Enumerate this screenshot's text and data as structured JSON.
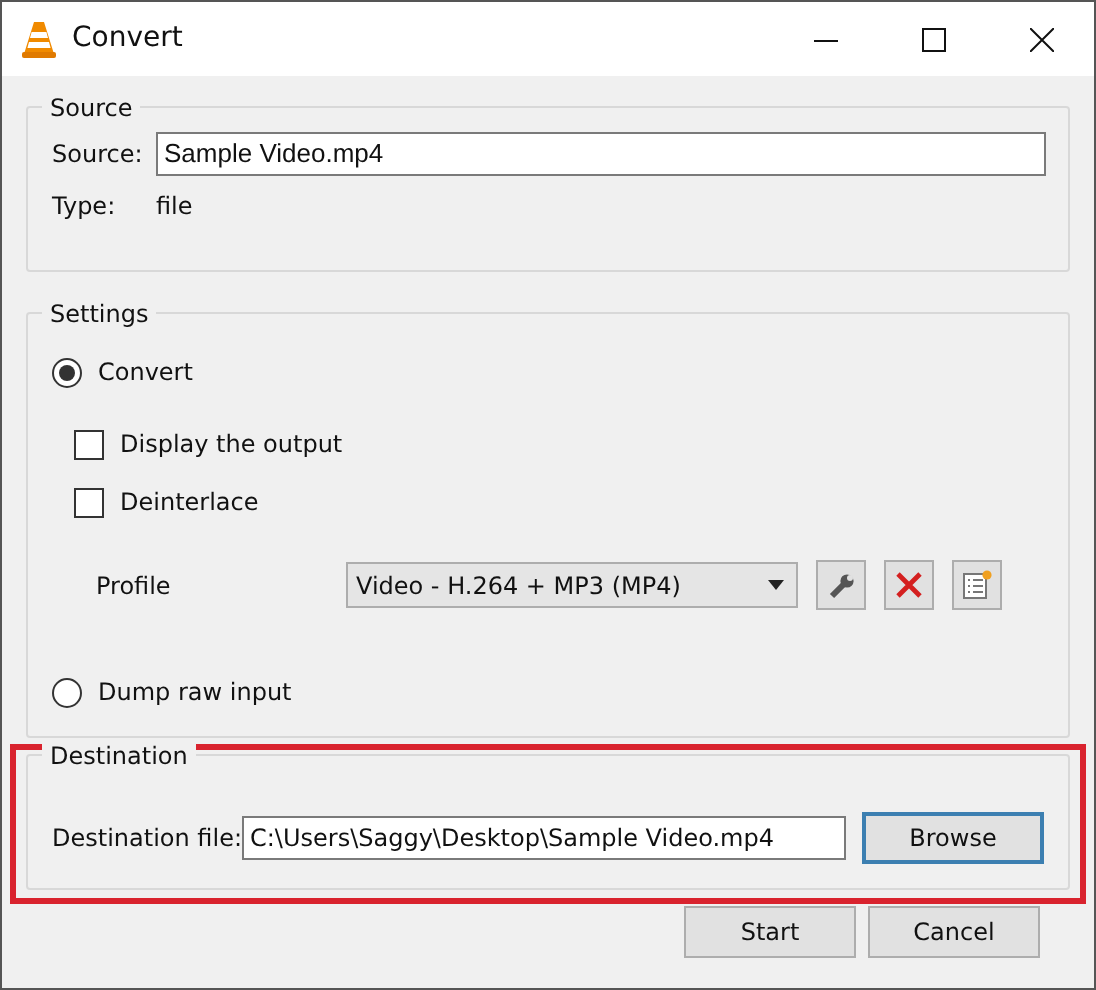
{
  "window": {
    "title": "Convert"
  },
  "source": {
    "legend": "Source",
    "source_label": "Source:",
    "source_value": "Sample Video.mp4",
    "type_label": "Type:",
    "type_value": "file"
  },
  "settings": {
    "legend": "Settings",
    "modes": [
      {
        "label": "Convert",
        "selected": true
      },
      {
        "label": "Dump raw input",
        "selected": false
      }
    ],
    "options": [
      {
        "label": "Display the output",
        "checked": false
      },
      {
        "label": "Deinterlace",
        "checked": false
      }
    ],
    "profile_label": "Profile",
    "profile_value": "Video - H.264 + MP3 (MP4)"
  },
  "destination": {
    "legend": "Destination",
    "file_label": "Destination file:",
    "file_value": "C:\\Users\\Saggy\\Desktop\\Sample Video.mp4",
    "browse": "Browse",
    "highlighted": true
  },
  "buttons": [
    "Start",
    "Cancel"
  ]
}
